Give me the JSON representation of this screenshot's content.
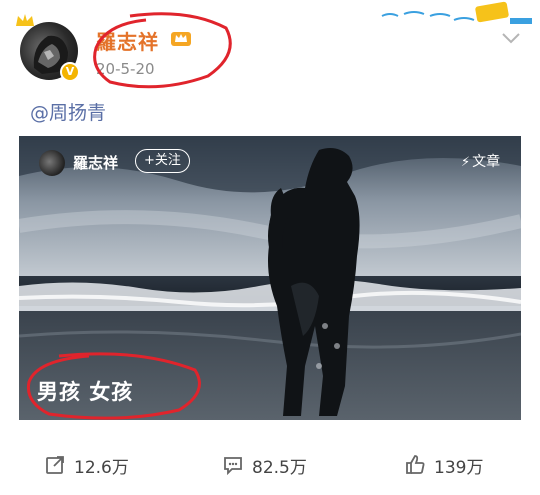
{
  "post": {
    "author": "羅志祥",
    "date": "20-5-20",
    "verified_badge": "V",
    "mention": "@周扬青"
  },
  "card": {
    "author": "羅志祥",
    "follow_label": "+关注",
    "article_label": "文章",
    "caption": "男孩 女孩"
  },
  "actions": {
    "repost_count": "12.6万",
    "comment_count": "82.5万",
    "like_count": "139万"
  },
  "icons": [
    "crown-icon",
    "vip-crown-icon",
    "verified-icon",
    "chevron-down-icon",
    "bolt-icon",
    "repost-icon",
    "comment-icon",
    "like-icon"
  ],
  "colors": {
    "author_name": "#e4732a",
    "mention": "#5a6fa6",
    "annotation_red": "#e0242c",
    "verified": "#f4b400"
  }
}
